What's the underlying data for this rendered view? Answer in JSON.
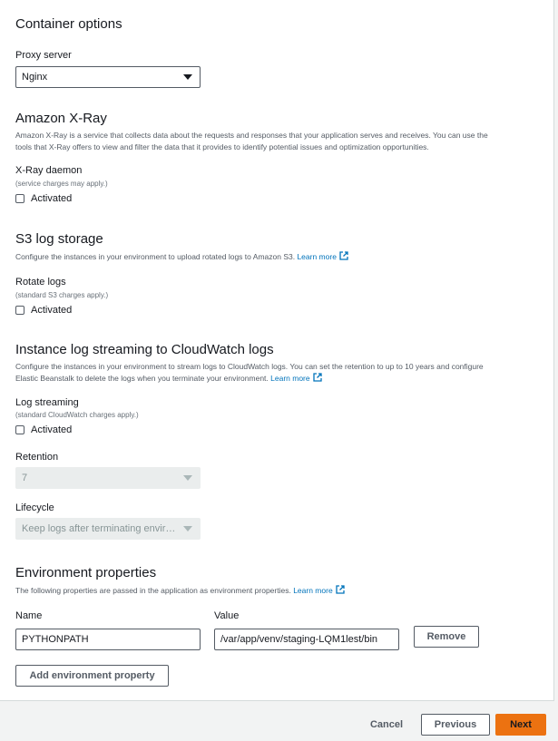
{
  "container": {
    "title": "Container options",
    "proxy_label": "Proxy server",
    "proxy_value": "Nginx"
  },
  "xray": {
    "title": "Amazon X-Ray",
    "desc_line1": "Amazon X-Ray is a service that collects data about the requests and responses that your application serves and receives. You can use the",
    "desc_line2": "tools that X-Ray offers to view and filter the data that it provides to identify potential issues and optimization opportunities.",
    "daemon_label": "X-Ray daemon",
    "daemon_sub": "(service charges may apply.)",
    "checkbox_label": "Activated"
  },
  "s3": {
    "title": "S3 log storage",
    "desc": "Configure the instances in your environment to upload rotated logs to Amazon S3.",
    "learn_more": "Learn more",
    "rotate_label": "Rotate logs",
    "rotate_sub": "(standard S3 charges apply.)",
    "checkbox_label": "Activated"
  },
  "cloudwatch": {
    "title": "Instance log streaming to CloudWatch logs",
    "desc_line1": "Configure the instances in your environment to stream logs to CloudWatch logs. You can set the retention to up to 10 years and configure",
    "desc_line2": "Elastic Beanstalk to delete the logs when you terminate your environment.",
    "learn_more": "Learn more",
    "streaming_label": "Log streaming",
    "streaming_sub": "(standard CloudWatch charges apply.)",
    "checkbox_label": "Activated",
    "retention_label": "Retention",
    "retention_value": "7",
    "lifecycle_label": "Lifecycle",
    "lifecycle_value": "Keep logs after terminating environment"
  },
  "env": {
    "title": "Environment properties",
    "desc": "The following properties are passed in the application as environment properties.",
    "learn_more": "Learn more",
    "name_header": "Name",
    "value_header": "Value",
    "rows": [
      {
        "name": "PYTHONPATH",
        "value": "/var/app/venv/staging-LQM1lest/bin"
      }
    ],
    "remove_label": "Remove",
    "add_label": "Add environment property"
  },
  "footer": {
    "cancel": "Cancel",
    "previous": "Previous",
    "next": "Next"
  },
  "colors": {
    "link": "#0073bb",
    "primary": "#ec7211"
  }
}
